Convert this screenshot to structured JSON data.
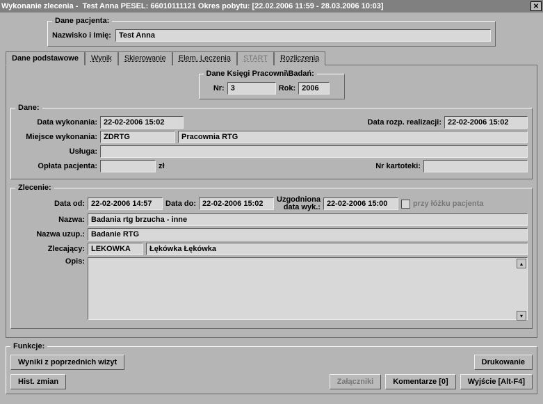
{
  "title": {
    "prefix": "Wykonanie zlecenia -  ",
    "name": "Test Anna",
    "pesel_label": " PESEL: ",
    "pesel": "66010111121",
    "okres_label": " Okres pobytu: ",
    "okres": "[22.02.2006 11:59 - 28.03.2006 10:03]"
  },
  "patient": {
    "legend": "Dane pacjenta:",
    "name_label": "Nazwisko i Imię:",
    "name": "Test Anna"
  },
  "tabs": {
    "podst": "Dane podstawowe",
    "wynik": "Wynik",
    "skier": "Skierowanie",
    "elem": "Elem. Leczenia",
    "start": "START",
    "rozl": "Rozliczenia"
  },
  "ksiegi": {
    "legend": "Dane Księgi Pracowni\\Badań:",
    "nr_label": "Nr:",
    "nr": "3",
    "rok_label": "Rok:",
    "rok": "2006"
  },
  "dane": {
    "legend": "Dane:",
    "data_wyk_label": "Data wykonania:",
    "data_wyk": "22-02-2006 15:02",
    "data_rozp_label": "Data rozp. realizacji:",
    "data_rozp": "22-02-2006 15:02",
    "miejsce_label": "Miejsce wykonania:",
    "miejsce_code": "ZDRTG",
    "miejsce_name": "Pracownia RTG",
    "usluga_label": "Usługa:",
    "usluga": "",
    "oplata_label": "Opłata pacjenta:",
    "oplata_val": "",
    "oplata_unit": "zł",
    "kartoteki_label": "Nr kartoteki:",
    "kartoteki_val": ""
  },
  "zlec": {
    "legend": "Zlecenie:",
    "data_od_label": "Data od:",
    "data_od": "22-02-2006 14:57",
    "data_do_label": "Data do:",
    "data_do": "22-02-2006 15:02",
    "uzg_label": "Uzgodniona\ndata wyk.:",
    "uzg_val": "22-02-2006 15:00",
    "przy_label": "przy łóżku pacjenta",
    "nazwa_label": "Nazwa:",
    "nazwa": "Badania rtg brzucha - inne",
    "nazwa_uzup_label": "Nazwa uzup.:",
    "nazwa_uzup": "Badanie RTG",
    "zlec_label": "Zlecający:",
    "zlec_code": "LEKOWKA",
    "zlec_name": "Łękówka Łękówka",
    "opis_label": "Opis:",
    "opis_val": ""
  },
  "funkcje": {
    "legend": "Funkcje:",
    "wyniki_btn": "Wyniki z poprzednich wizyt",
    "drukowanie_btn": "Drukowanie",
    "hist_btn": "Hist. zmian",
    "zal_btn": "Załączniki",
    "kom_btn": "Komentarze [0]",
    "wyj_btn": "Wyjście [Alt-F4]"
  }
}
